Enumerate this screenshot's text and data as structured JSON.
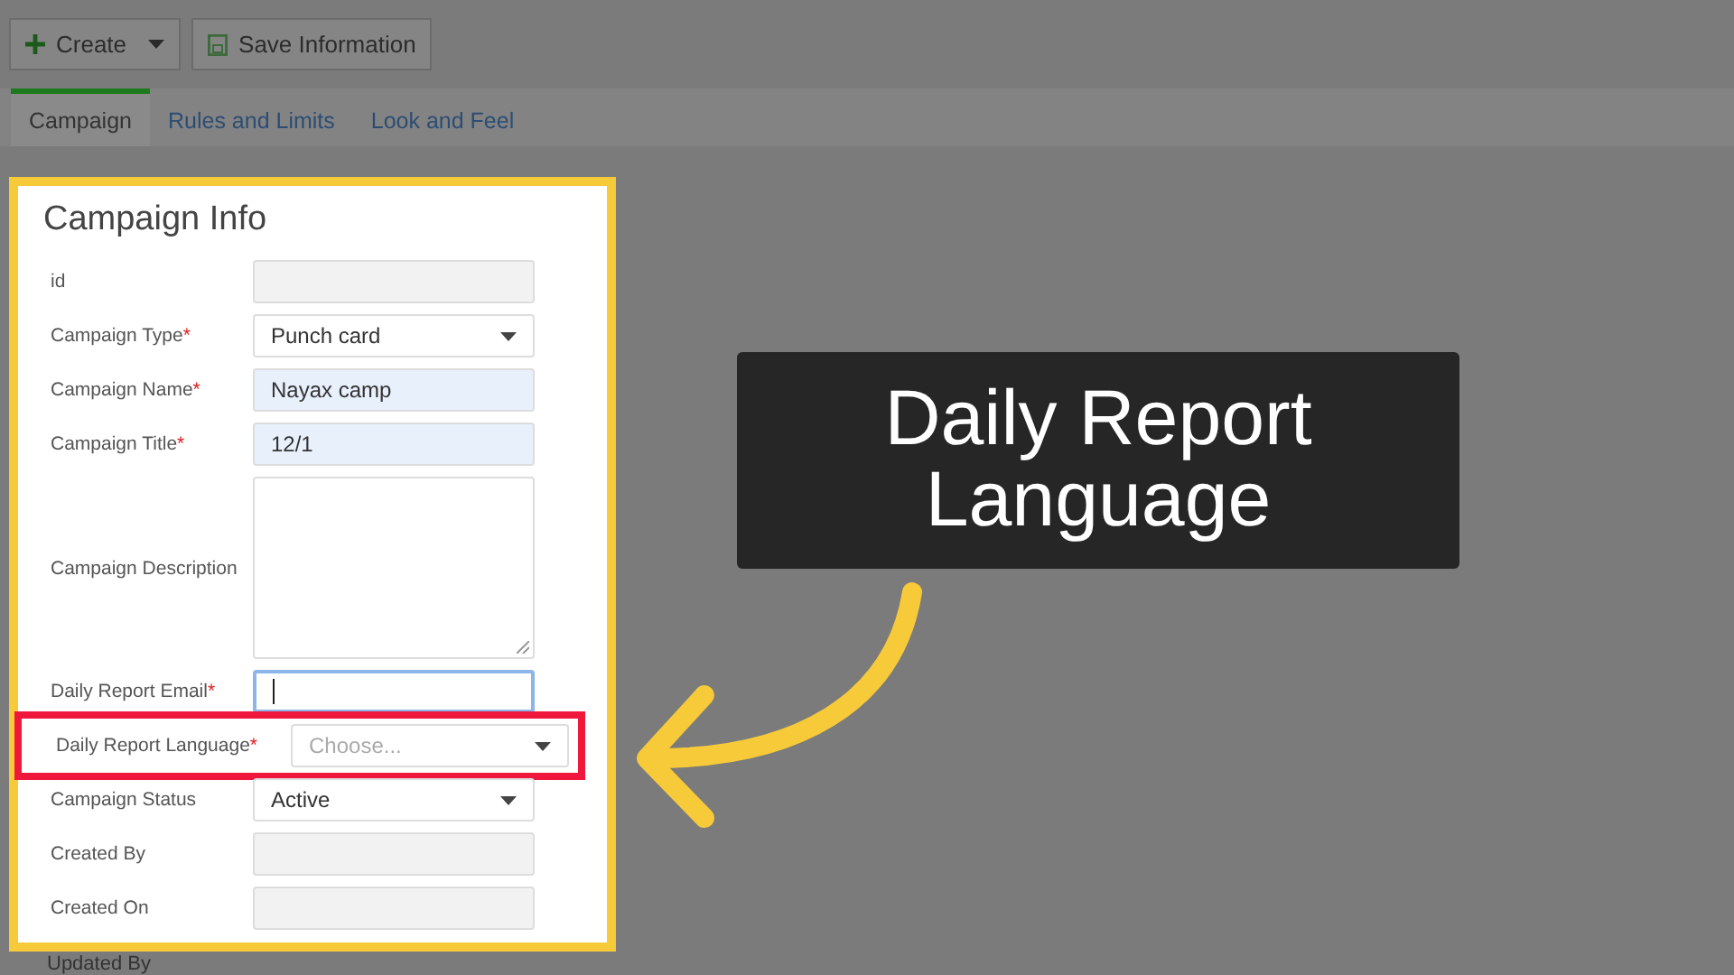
{
  "toolbar": {
    "buttons": [
      {
        "kind": "create",
        "label": "Create"
      },
      {
        "kind": "save",
        "label": "Save Information"
      }
    ]
  },
  "tabs": [
    {
      "label": "Campaign",
      "selected": true
    },
    {
      "label": "Rules and Limits",
      "selected": false
    },
    {
      "label": "Look and Feel",
      "selected": false
    }
  ],
  "form": {
    "title": "Campaign Info",
    "fields": [
      {
        "label": "id",
        "kind": "readonly",
        "highlighted": false
      },
      {
        "label": "Campaign Type",
        "required_mark": "*",
        "kind": "select",
        "value": "Punch card",
        "highlighted": false
      },
      {
        "label": "Campaign Name",
        "required_mark": "*",
        "kind": "filled",
        "value": "Nayax camp",
        "highlighted": false
      },
      {
        "label": "Campaign Title",
        "required_mark": "*",
        "kind": "filled",
        "value": "12/1",
        "highlighted": false
      },
      {
        "label": "Campaign Description",
        "kind": "textarea",
        "highlighted": false
      },
      {
        "label": "Daily Report Email",
        "required_mark": "*",
        "kind": "focused",
        "highlighted": false
      },
      {
        "label": "Daily Report Language",
        "required_mark": "*",
        "kind": "select",
        "placeholder": "Choose...",
        "highlighted": true
      },
      {
        "label": "Campaign Status",
        "kind": "select",
        "value": "Active",
        "highlighted": false
      },
      {
        "label": "Created By",
        "kind": "readonly",
        "highlighted": false
      },
      {
        "label": "Created On",
        "kind": "readonly",
        "highlighted": false
      }
    ],
    "below_label": "Updated By"
  },
  "callout": {
    "text": "Daily Report Language"
  }
}
